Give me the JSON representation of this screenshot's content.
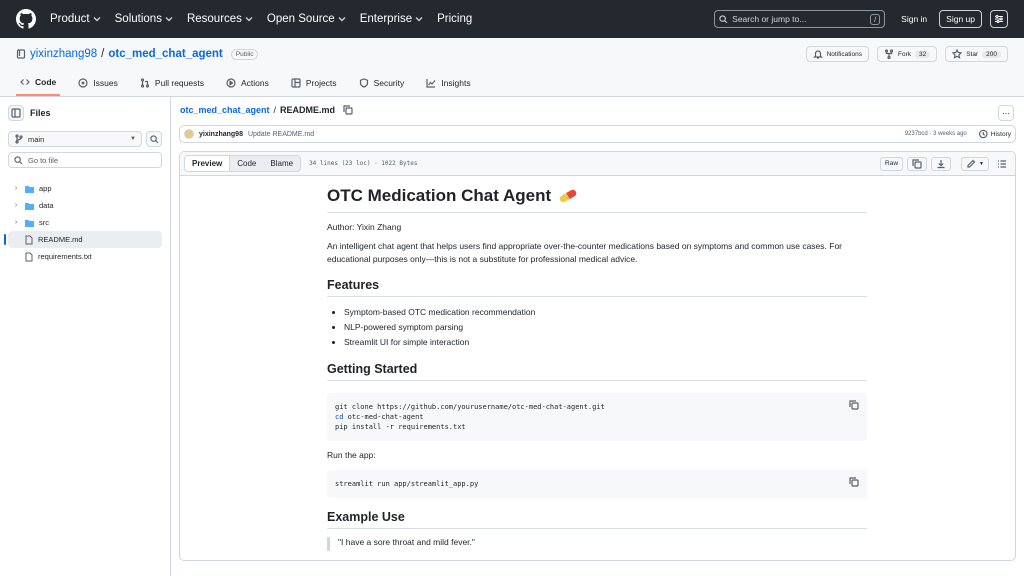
{
  "topbar": {
    "nav": [
      "Product",
      "Solutions",
      "Resources",
      "Open Source",
      "Enterprise",
      "Pricing"
    ],
    "search_placeholder": "Search or jump to...",
    "search_shortcut": "/",
    "sign_in": "Sign in",
    "sign_up": "Sign up"
  },
  "repo": {
    "owner": "yixinzhang98",
    "separator": "/",
    "name": "otc_med_chat_agent",
    "visibility": "Public",
    "notifications": "Notifications",
    "fork_label": "Fork",
    "fork_count": "32",
    "star_label": "Star",
    "star_count": "200",
    "tabs": [
      "Code",
      "Issues",
      "Pull requests",
      "Actions",
      "Projects",
      "Security",
      "Insights"
    ]
  },
  "sidebar": {
    "title": "Files",
    "branch": "main",
    "go_to_file": "Go to file",
    "tree": [
      {
        "name": "app",
        "type": "folder"
      },
      {
        "name": "data",
        "type": "folder"
      },
      {
        "name": "src",
        "type": "folder"
      },
      {
        "name": "README.md",
        "type": "file"
      },
      {
        "name": "requirements.txt",
        "type": "file"
      }
    ]
  },
  "breadcrumb": {
    "repo": "otc_med_chat_agent",
    "sep": "/",
    "file": "README.md"
  },
  "commit": {
    "author": "yixinzhang98",
    "message": "Update README.md",
    "meta": "9237bcd · 3 weeks ago",
    "history": "History"
  },
  "file_header": {
    "tabs": [
      "Preview",
      "Code",
      "Blame"
    ],
    "info": "34 lines (23 loc) · 1022 Bytes",
    "raw": "Raw"
  },
  "readme": {
    "title": "OTC Medication Chat Agent",
    "author": "Author: Yixin Zhang",
    "intro": "An intelligent chat agent that helps users find appropriate over-the-counter medications based on symptoms and common use cases. For educational purposes only—this is not a substitute for professional medical advice.",
    "features_h": "Features",
    "features": [
      "Symptom-based OTC medication recommendation",
      "NLP-powered symptom parsing",
      "Streamlit UI for simple interaction"
    ],
    "getting_started_h": "Getting Started",
    "code1_line1": "git clone https://github.com/yourusername/otc-med-chat-agent.git",
    "code1_kw": "cd",
    "code1_line2_rest": " otc-med-chat-agent",
    "code1_line3": "pip install -r requirements.txt",
    "run_app": "Run the app:",
    "code2": "streamlit run app/streamlit_app.py",
    "example_h": "Example Use",
    "quote": "\"I have a sore throat and mild fever.\""
  },
  "colors": {
    "topbar": "#24292f",
    "link": "#0969da",
    "tab_underline": "#fd8c73"
  }
}
